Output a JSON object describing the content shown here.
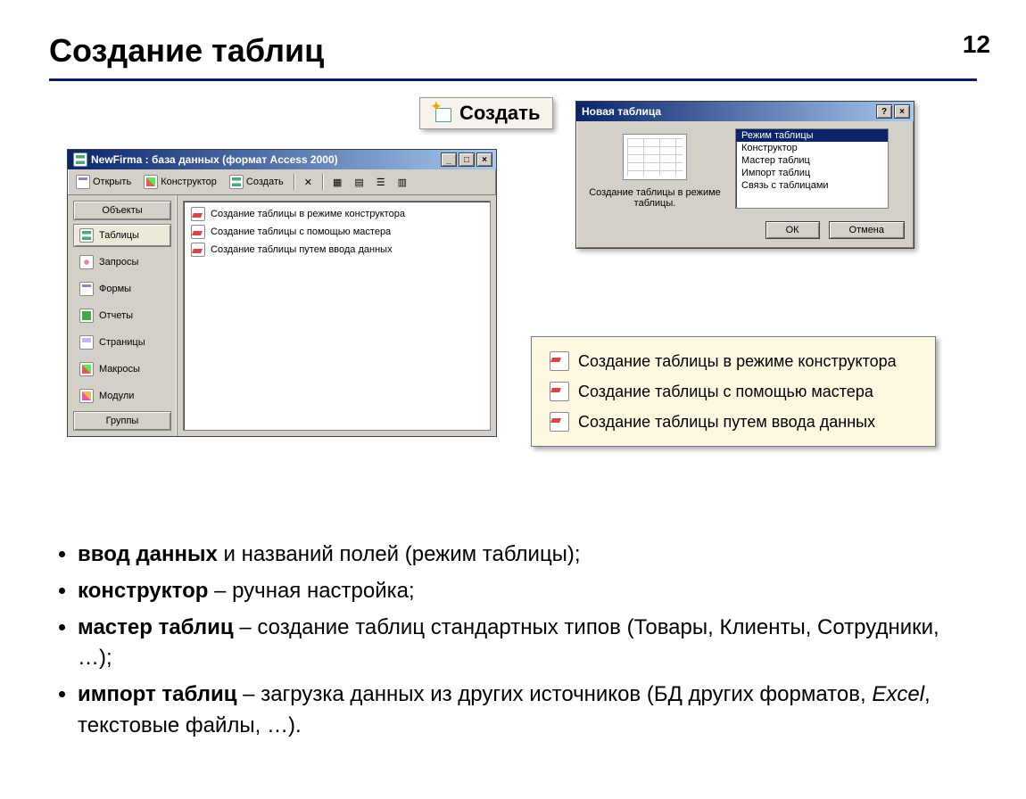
{
  "page_number": "12",
  "title": "Создание таблиц",
  "create_button_label": "Создать",
  "db_window": {
    "title": "NewFirma : база данных (формат Access 2000)",
    "toolbar": {
      "open": "Открыть",
      "design": "Конструктор",
      "create": "Создать"
    },
    "sidebar": {
      "objects_header": "Объекты",
      "items": [
        "Таблицы",
        "Запросы",
        "Формы",
        "Отчеты",
        "Страницы",
        "Макросы",
        "Модули"
      ],
      "groups_header": "Группы"
    },
    "list_items": [
      "Создание таблицы в режиме конструктора",
      "Создание таблицы с помощью мастера",
      "Создание таблицы путем ввода данных"
    ]
  },
  "dialog": {
    "title": "Новая таблица",
    "description": "Создание таблицы в режиме таблицы.",
    "options": [
      "Режим таблицы",
      "Конструктор",
      "Мастер таблиц",
      "Импорт таблиц",
      "Связь с таблицами"
    ],
    "ok": "ОК",
    "cancel": "Отмена"
  },
  "callout_items": [
    "Создание таблицы в режиме конструктора",
    "Создание таблицы с помощью мастера",
    "Создание таблицы путем ввода данных"
  ],
  "bullets": {
    "b1_bold": "ввод данных",
    "b1_rest": " и названий полей (режим таблицы);",
    "b2_bold": "конструктор",
    "b2_rest": " – ручная настройка;",
    "b3_bold": "мастер таблиц",
    "b3_rest": " – создание таблиц стандартных типов (Товары, Клиенты, Сотрудники, …);",
    "b4_bold": "импорт таблиц",
    "b4_rest_a": " – загрузка данных из других источников (БД других форматов, ",
    "b4_italic": "Excel",
    "b4_rest_b": ", текстовые файлы, …)."
  }
}
